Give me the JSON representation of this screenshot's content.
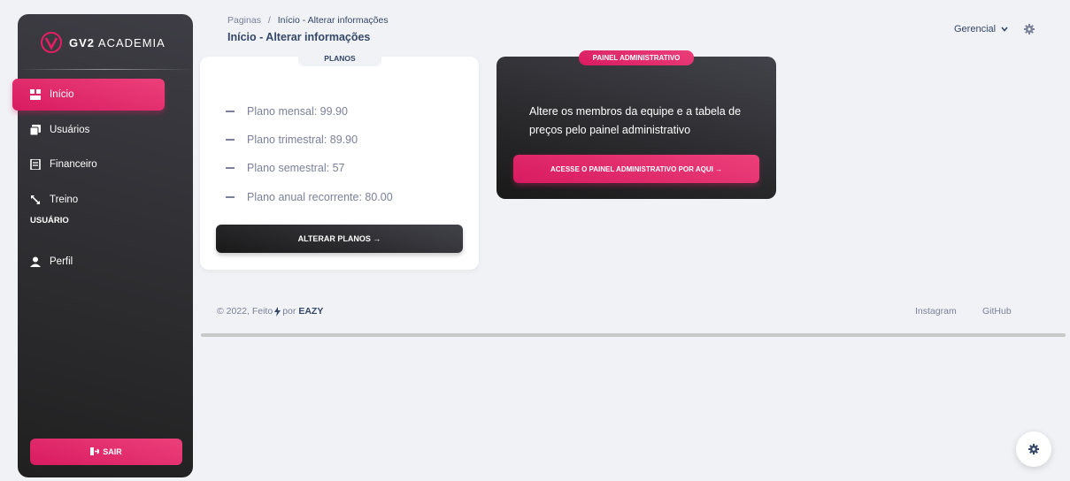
{
  "sidebar": {
    "brand_bold": "GV2",
    "brand_rest": " ACADEMIA",
    "items": [
      {
        "label": "Início",
        "icon": "dashboard-icon",
        "active": true
      },
      {
        "label": "Usuários",
        "icon": "users-icon",
        "active": false
      },
      {
        "label": "Financeiro",
        "icon": "receipt-icon",
        "active": false
      },
      {
        "label": "Treino",
        "icon": "arrows-icon",
        "active": false
      }
    ],
    "section_label": "USUÁRIO",
    "profile_item": {
      "label": "Perfil",
      "icon": "person-icon"
    },
    "logout_label": "SAIR"
  },
  "header": {
    "breadcrumb_root": "Paginas",
    "breadcrumb_separator": "/",
    "breadcrumb_current": "Início - Alterar informações",
    "title": "Início - Alterar informações",
    "role_select": "Gerencial"
  },
  "plans_card": {
    "tab_label": "PLANOS",
    "plans": [
      "Plano mensal: 99.90",
      "Plano trimestral: 89.90",
      "Plano semestral: 57",
      "Plano anual recorrente: 80.00"
    ],
    "button_label": "ALTERAR PLANOS →"
  },
  "admin_card": {
    "badge_label": "PAINEL ADMINISTRATIVO",
    "text": "Altere os membros da equipe e a tabela de preços pelo painel administrativo",
    "button_label": "ACESSE O PAINEL ADMINISTRATIVO POR AQUI →"
  },
  "footer": {
    "copyright_prefix": "© 2022, Feito",
    "copyright_middle": "por",
    "copyright_brand": "EAZY",
    "links": [
      "Instagram",
      "GitHub"
    ]
  },
  "colors": {
    "accent": "#e91e63",
    "dark": "#202020",
    "background": "#f0f2f5"
  }
}
